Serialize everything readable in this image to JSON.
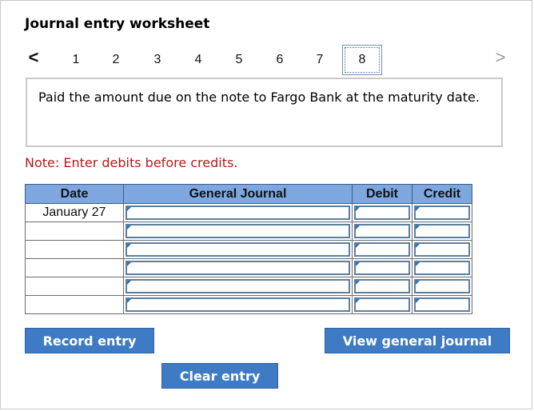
{
  "worksheet": {
    "title": "Journal entry worksheet",
    "nav": {
      "prev": "<",
      "next": ">"
    },
    "steps": [
      "1",
      "2",
      "3",
      "4",
      "5",
      "6",
      "7",
      "8"
    ],
    "active_step": "8",
    "question": "Paid the amount due on the note to Fargo Bank at the maturity date.",
    "note": "Note: Enter debits before credits."
  },
  "table": {
    "headers": {
      "date": "Date",
      "journal": "General Journal",
      "debit": "Debit",
      "credit": "Credit"
    },
    "rows": [
      {
        "date": "January 27"
      },
      {
        "date": ""
      },
      {
        "date": ""
      },
      {
        "date": ""
      },
      {
        "date": ""
      },
      {
        "date": ""
      }
    ]
  },
  "buttons": {
    "record": "Record entry",
    "view": "View general journal",
    "clear": "Clear entry"
  },
  "colors": {
    "header_bg": "#7ea7df",
    "button_bg": "#3e7bc4",
    "note_text": "#b41a1a"
  }
}
